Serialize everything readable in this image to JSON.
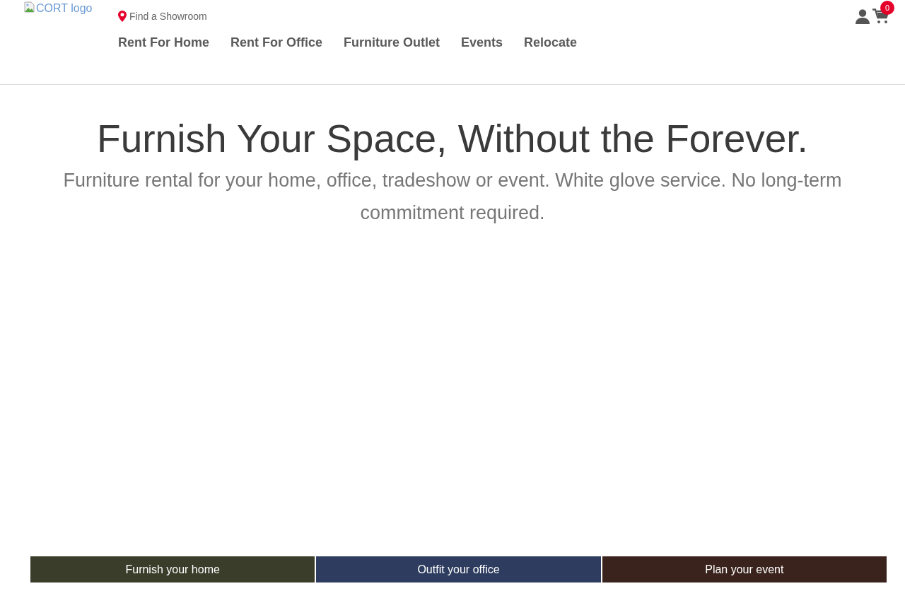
{
  "header": {
    "logo_alt": "CORT logo",
    "showroom_link": "Find a Showroom",
    "nav": [
      "Rent For Home",
      "Rent For Office",
      "Furniture Outlet",
      "Events",
      "Relocate"
    ],
    "cart_count": "0"
  },
  "hero": {
    "title": "Furnish Your Space, Without the Forever.",
    "subtitle": "Furniture rental for your home, office, tradeshow or event. White glove service. No long-term commitment required."
  },
  "tiles": [
    {
      "label": "Furnish your home",
      "color": "#3b3d2b"
    },
    {
      "label": "Outfit your office",
      "color": "#2e3d5f"
    },
    {
      "label": "Plan your event",
      "color": "#3a231d"
    }
  ]
}
